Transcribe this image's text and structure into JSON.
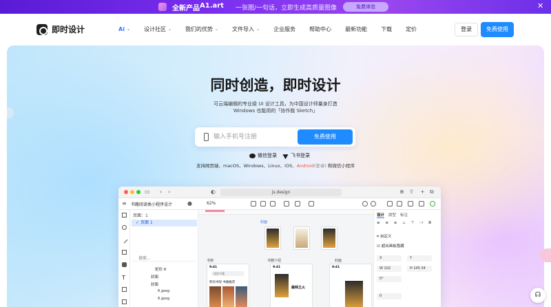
{
  "promo": {
    "prefix": "全新产品",
    "product": "A1.art",
    "tagline": "一张图/一句话，立即生成高质量图像",
    "cta": "免费体验",
    "close_icon": "close-icon"
  },
  "nav": {
    "brand": "即时设计",
    "links": [
      {
        "label": "Ai",
        "dropdown": true
      },
      {
        "label": "设计社区",
        "dropdown": true
      },
      {
        "label": "我们的优势",
        "dropdown": true
      },
      {
        "label": "文件导入",
        "dropdown": true
      },
      {
        "label": "企业服务",
        "dropdown": false
      },
      {
        "label": "帮助中心",
        "dropdown": false
      },
      {
        "label": "最新功能",
        "dropdown": false
      },
      {
        "label": "下载",
        "dropdown": false
      },
      {
        "label": "定价",
        "dropdown": false
      }
    ],
    "login": "登录",
    "free": "免费使用"
  },
  "hero": {
    "title": "同时创造，即时设计",
    "subtitle_line1": "可云端编辑的专业级 UI 设计工具，为中国设计师量身打造",
    "subtitle_line2": "Windows 也能用的「协作版 Sketch」",
    "phone_placeholder": "输入手机号注册",
    "cta": "免费使用",
    "wechat_login": "微信登录",
    "feishu_login": "飞书登录",
    "platforms_prefix": "支持网页端、macOS、Windows、Linux、iOS、",
    "platforms_android": "Android",
    "platforms_android_note": "(安卓)",
    "platforms_suffix": " 和微信小程序"
  },
  "app": {
    "url": "js.design",
    "doc_name": "书籍阅读类小程序设计",
    "zoom": "62%",
    "pages_label": "页面：1",
    "page_name": "页面 1",
    "layer_search": "搜索...",
    "layers": [
      "矩形 8",
      "封面",
      "封面",
      "6.jpeg",
      "6.jpeg"
    ],
    "selection_label": "封面",
    "artboards": [
      "书架",
      "书籍介绍",
      "封面"
    ],
    "phone_time": "9:41",
    "phone_tabs": "熊的书架    书籍推荐",
    "phone_search": "搜索书籍",
    "book_title": "森林之火",
    "inspector_tabs": [
      "设计",
      "原型",
      "标注"
    ],
    "custom_label": "自定义",
    "clip_label": "超出画板隐藏",
    "fields": {
      "x": "X",
      "y": "Y",
      "w_label": "W",
      "w": "102",
      "h_label": "H",
      "h": "145.34",
      "rot": "0",
      "rot_unit": "°",
      "radius": "0"
    }
  }
}
